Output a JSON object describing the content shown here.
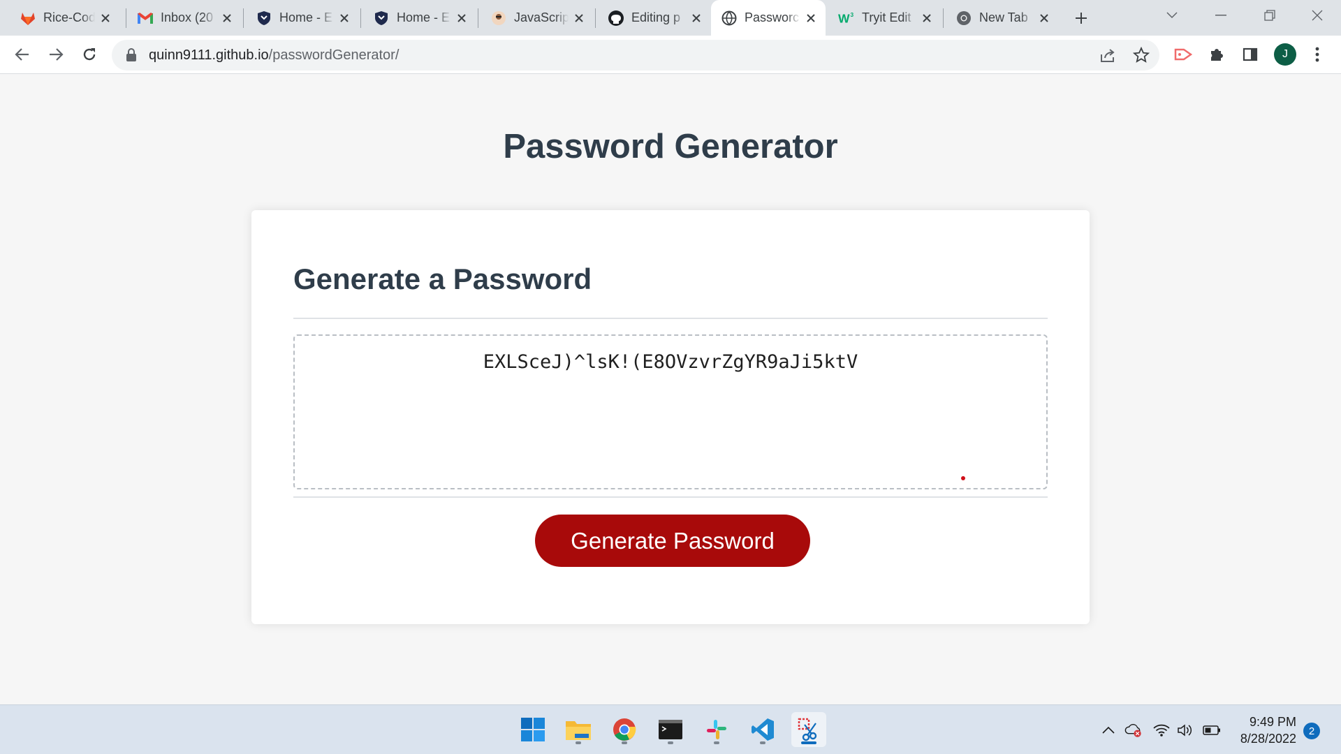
{
  "browser": {
    "tabs": [
      {
        "title": "Rice-Cod",
        "icon": "gitlab-icon"
      },
      {
        "title": "Inbox (20",
        "icon": "gmail-icon"
      },
      {
        "title": "Home - E",
        "icon": "shield-icon"
      },
      {
        "title": "Home - E",
        "icon": "shield-icon"
      },
      {
        "title": "JavaScrip",
        "icon": "person-avatar-icon"
      },
      {
        "title": "Editing p",
        "icon": "github-icon"
      },
      {
        "title": "Passworc",
        "icon": "globe-icon",
        "active": true
      },
      {
        "title": "Tryit Edit",
        "icon": "w3schools-icon"
      },
      {
        "title": "New Tab",
        "icon": "chrome-icon"
      }
    ],
    "url_host": "quinn9111.github.io",
    "url_path": "/passwordGenerator/",
    "profile_initial": "J"
  },
  "page": {
    "title": "Password Generator",
    "card_header": "Generate a Password",
    "password_value": "EXLSceJ)^lsK!(E8OVzvrZgYR9aJi5ktV",
    "button_label": "Generate Password"
  },
  "taskbar": {
    "apps": [
      "windows-start-icon",
      "file-explorer-icon",
      "chrome-icon",
      "terminal-icon",
      "slack-icon",
      "vscode-icon",
      "snipping-tool-icon"
    ],
    "time": "9:49 PM",
    "date": "8/28/2022",
    "notification_count": "2"
  },
  "colors": {
    "accent_button": "#a80a0a",
    "heading_text": "#2f3d4a",
    "page_background": "#f6f6f6"
  }
}
